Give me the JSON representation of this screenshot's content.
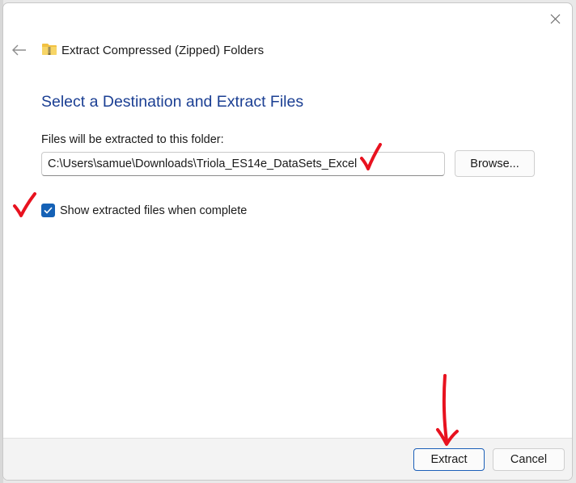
{
  "window": {
    "title": "Extract Compressed (Zipped) Folders",
    "back_icon": "arrow-left-icon",
    "close_icon": "close-icon",
    "folder_icon": "zip-folder-icon"
  },
  "main": {
    "heading": "Select a Destination and Extract Files",
    "field_label": "Files will be extracted to this folder:",
    "path_value": "C:\\Users\\samue\\Downloads\\Triola_ES14e_DataSets_Excel",
    "browse_label": "Browse...",
    "show_files_label": "Show extracted files when complete",
    "show_files_checked": true
  },
  "footer": {
    "extract_label": "Extract",
    "cancel_label": "Cancel"
  },
  "colors": {
    "heading": "#1b3f93",
    "checkbox": "#1561b6",
    "annotation": "#e8121f"
  }
}
